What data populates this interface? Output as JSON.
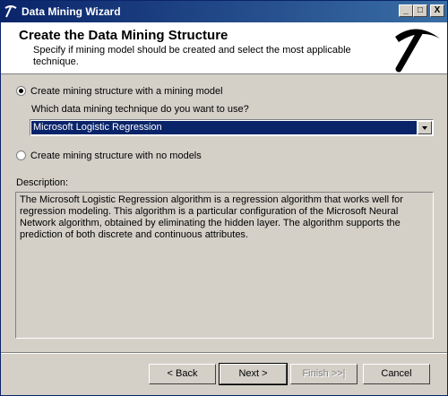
{
  "window": {
    "title": "Data Mining Wizard",
    "controls": [
      "_",
      "□",
      "X"
    ]
  },
  "header": {
    "title": "Create the Data Mining Structure",
    "subtitle": "Specify if mining model should be created and select the most applicable technique.",
    "icon": "pickaxe-icon"
  },
  "options": {
    "with_model": {
      "label": "Create mining structure with a mining  model",
      "checked": true
    },
    "technique_prompt": "Which data mining technique do you want to use?",
    "technique_selected": "Microsoft Logistic Regression",
    "no_models": {
      "label": "Create mining structure with no models",
      "checked": false
    }
  },
  "description": {
    "label": "Description:",
    "text": "The Microsoft Logistic Regression algorithm is a regression algorithm that works well for regression modeling. This algorithm is a particular configuration of the Microsoft Neural Network algorithm, obtained by eliminating the hidden layer.  The algorithm supports the prediction of both discrete and continuous attributes."
  },
  "buttons": {
    "back": "< Back",
    "next": "Next >",
    "finish": "Finish >>|",
    "cancel": "Cancel"
  }
}
